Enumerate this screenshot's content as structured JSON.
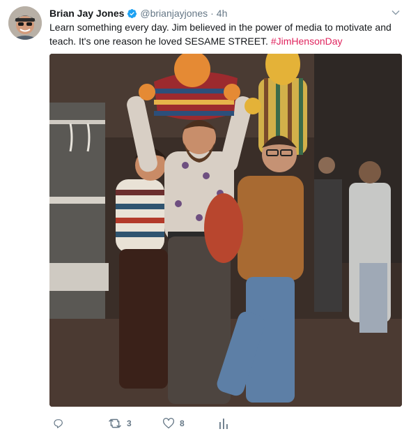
{
  "tweet": {
    "author_name": "Brian Jay Jones",
    "handle": "@brianjayjones",
    "separator": "·",
    "time": "4h",
    "text_main": "Learn something every day. Jim believed in the power of media to motivate and teach. It's one reason he loved SESAME STREET. ",
    "hashtag": "#JimHensonDay",
    "photo_alt_icon": "photo",
    "verified_icon": "verified-badge-icon",
    "colors": {
      "verified": "#1da1f2",
      "hashtag": "#e0245e",
      "muted": "#657786"
    }
  },
  "actions": {
    "reply_count": "",
    "retweet_count": "3",
    "like_count": "8",
    "icons": [
      "reply-icon",
      "retweet-icon",
      "like-icon",
      "analytics-icon"
    ]
  }
}
